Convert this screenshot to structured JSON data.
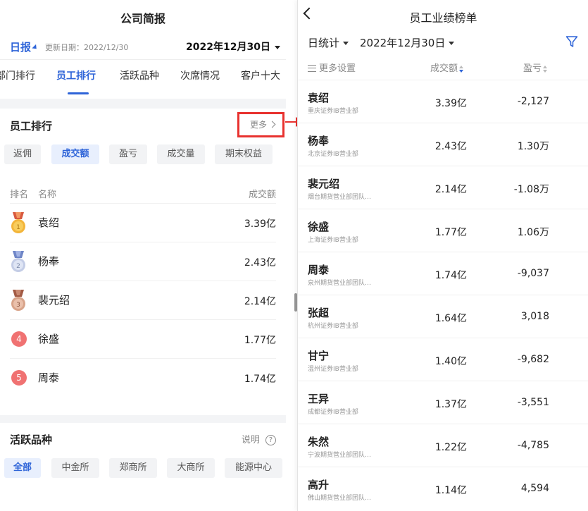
{
  "left": {
    "title": "公司简报",
    "period": "日报",
    "update_label": "更新日期：2022/12/30",
    "date": "2022年12月30日",
    "tabs": [
      "部门排行",
      "员工排行",
      "活跃品种",
      "次席情况",
      "客户十大"
    ],
    "active_tab": "员工排行",
    "rank_card": {
      "title": "员工排行",
      "more": "更多",
      "chips": [
        "返佣",
        "成交额",
        "盈亏",
        "成交量",
        "期末权益"
      ],
      "active_chip": "成交额",
      "headers": {
        "rank": "排名",
        "name": "名称",
        "value": "成交额"
      },
      "rows": [
        {
          "rank": "1",
          "name": "袁绍",
          "value": "3.39亿",
          "medal": "gold"
        },
        {
          "rank": "2",
          "name": "杨奉",
          "value": "2.43亿",
          "medal": "silver"
        },
        {
          "rank": "3",
          "name": "裴元绍",
          "value": "2.14亿",
          "medal": "bronze"
        },
        {
          "rank": "4",
          "name": "徐盛",
          "value": "1.77亿",
          "medal": ""
        },
        {
          "rank": "5",
          "name": "周泰",
          "value": "1.74亿",
          "medal": ""
        }
      ]
    },
    "active_card": {
      "title": "活跃品种",
      "help": "说明",
      "chips": [
        "全部",
        "中金所",
        "郑商所",
        "大商所",
        "能源中心"
      ],
      "active_chip": "全部"
    }
  },
  "right": {
    "title": "员工业绩榜单",
    "period": "日统计",
    "date": "2022年12月30日",
    "settings": "更多设置",
    "col_amount": "成交额",
    "col_pnl": "盈亏",
    "rows": [
      {
        "name": "袁绍",
        "dept": "重庆证券IB营业部",
        "amount": "3.39亿",
        "pnl": "-2,127"
      },
      {
        "name": "杨奉",
        "dept": "北京证券IB营业部",
        "amount": "2.43亿",
        "pnl": "1.30万"
      },
      {
        "name": "裴元绍",
        "dept": "烟台期货营业部团队…",
        "amount": "2.14亿",
        "pnl": "-1.08万"
      },
      {
        "name": "徐盛",
        "dept": "上海证券IB营业部",
        "amount": "1.77亿",
        "pnl": "1.06万"
      },
      {
        "name": "周泰",
        "dept": "泉州期货营业部团队…",
        "amount": "1.74亿",
        "pnl": "-9,037"
      },
      {
        "name": "张超",
        "dept": "杭州证券IB营业部",
        "amount": "1.64亿",
        "pnl": "3,018"
      },
      {
        "name": "甘宁",
        "dept": "温州证券IB营业部",
        "amount": "1.40亿",
        "pnl": "-9,682"
      },
      {
        "name": "王异",
        "dept": "成都证券IB营业部",
        "amount": "1.37亿",
        "pnl": "-3,551"
      },
      {
        "name": "朱然",
        "dept": "宁波期货营业部团队…",
        "amount": "1.22亿",
        "pnl": "-4,785"
      },
      {
        "name": "高升",
        "dept": "佛山期货营业部团队…",
        "amount": "1.14亿",
        "pnl": "4,594"
      }
    ]
  },
  "colors": {
    "accent": "#2e64d8",
    "annotation": "#e8322f",
    "rank_badge": "#f07272"
  }
}
